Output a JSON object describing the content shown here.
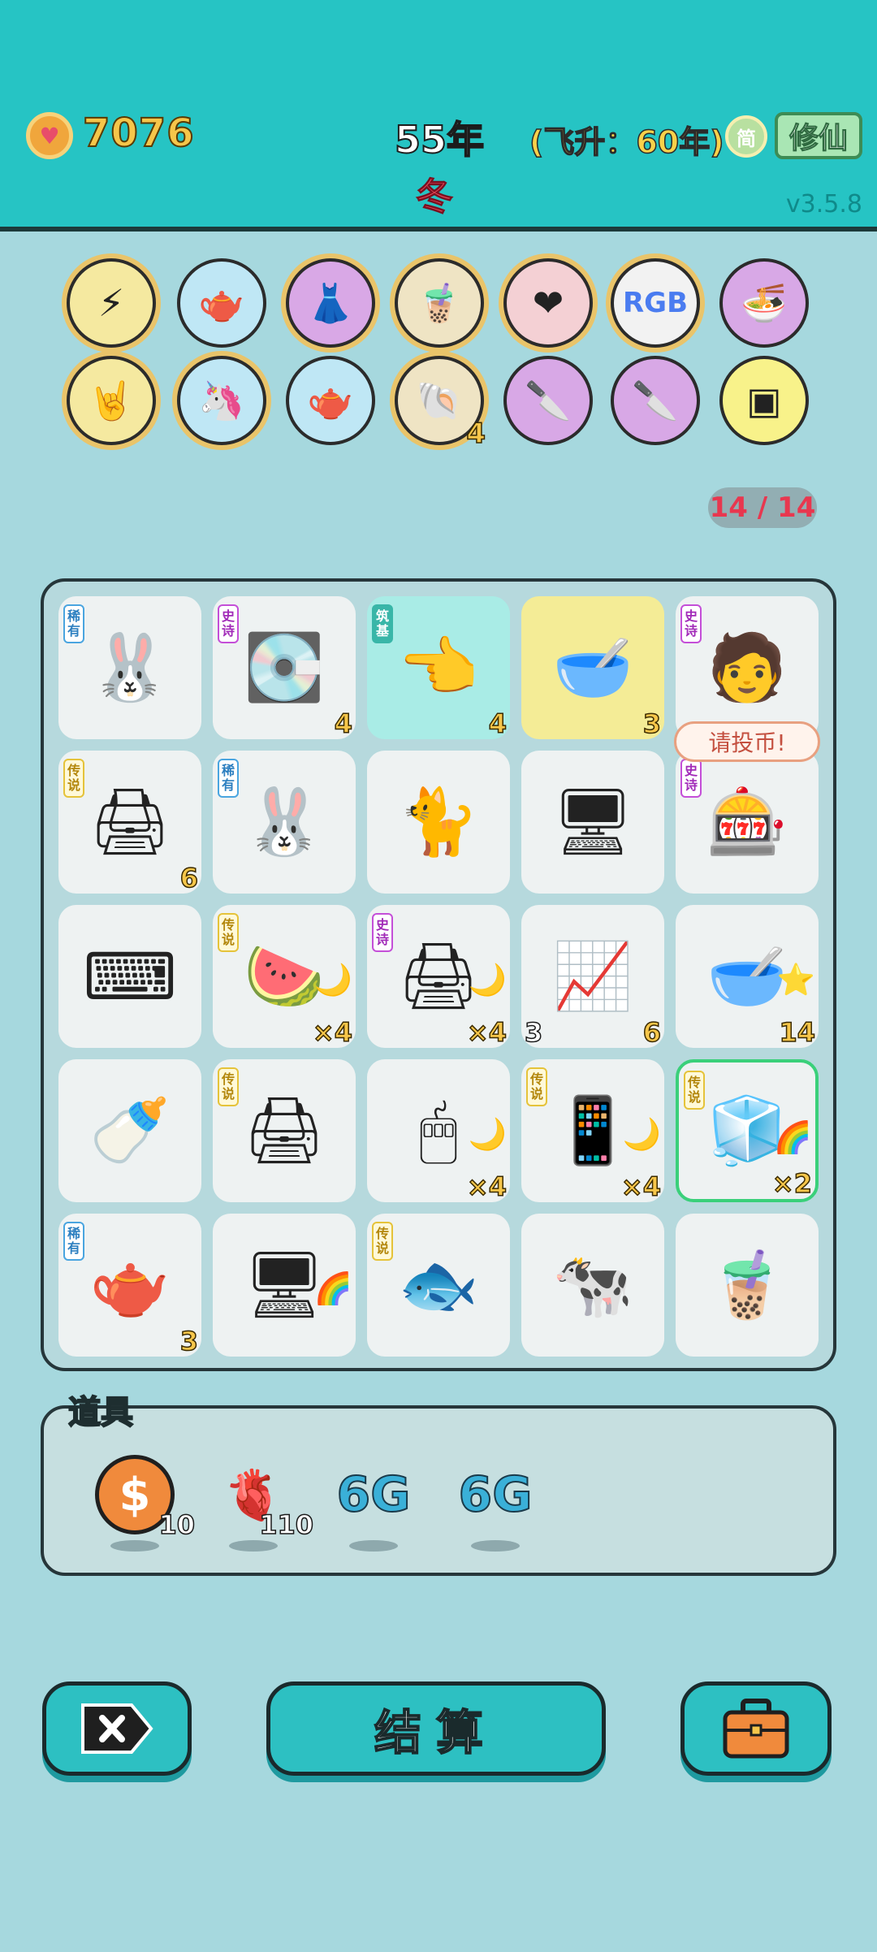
{
  "header": {
    "coins": "7076",
    "year": "55年",
    "season": "冬",
    "ascension": "(飞升：60年)",
    "simplified_label": "简",
    "cultivate_label": "修仙",
    "version": "v3.5.8",
    "colors": {
      "bar": "#26c4c4",
      "coin": "#f6c64a",
      "season": "#ee4a5a"
    }
  },
  "buffs": [
    {
      "icon": "lightning-icon",
      "glyph": "⚡",
      "count": ""
    },
    {
      "icon": "gravy-boat-icon",
      "glyph": "🫖",
      "count": ""
    },
    {
      "icon": "skirt-icon",
      "glyph": "👗",
      "count": ""
    },
    {
      "icon": "boba-tea-icon",
      "glyph": "🧋",
      "count": ""
    },
    {
      "icon": "heart-potion-icon",
      "glyph": "❤",
      "count": ""
    },
    {
      "icon": "rgb-icon",
      "glyph": "RGB",
      "count": ""
    },
    {
      "icon": "ramen-bowls-icon",
      "glyph": "🍜",
      "count": ""
    },
    {
      "icon": "rock-hand-icon",
      "glyph": "🤘",
      "count": ""
    },
    {
      "icon": "unicorn-icon",
      "glyph": "🦄",
      "count": ""
    },
    {
      "icon": "gravy-boat-icon",
      "glyph": "🫖",
      "count": ""
    },
    {
      "icon": "shell-icon",
      "glyph": "🐚",
      "count": "4"
    },
    {
      "icon": "cleaver-icon",
      "glyph": "🔪",
      "count": ""
    },
    {
      "icon": "cleaver-icon",
      "glyph": "🔪",
      "count": ""
    },
    {
      "icon": "cpu-chip-icon",
      "glyph": "▣",
      "count": ""
    }
  ],
  "inventory_counter": "14 / 14",
  "board": {
    "speech_bubble": "请投币!",
    "tiles": [
      {
        "icon": "rabbit-icon",
        "glyph": "🐰",
        "tag": "稀有",
        "tag_type": "rare",
        "count": "",
        "left_count": "",
        "side": ""
      },
      {
        "icon": "graphics-card-icon",
        "glyph": "💽",
        "tag": "史诗",
        "tag_type": "epic",
        "count": "4",
        "left_count": "",
        "side": ""
      },
      {
        "icon": "pointing-hand-icon",
        "glyph": "👈",
        "tag": "筑基",
        "tag_type": "found",
        "count": "4",
        "left_count": "",
        "side": ""
      },
      {
        "icon": "soup-bowl-icon",
        "glyph": "🥣",
        "tag": "",
        "tag_type": "",
        "count": "3",
        "left_count": "",
        "side": ""
      },
      {
        "icon": "face-with-cap-icon",
        "glyph": "🧑",
        "tag": "史诗",
        "tag_type": "epic",
        "count": "",
        "left_count": "",
        "side": ""
      },
      {
        "icon": "printer-icon",
        "glyph": "🖨",
        "tag": "传说",
        "tag_type": "leg",
        "count": "6",
        "left_count": "",
        "side": ""
      },
      {
        "icon": "rabbit-icon",
        "glyph": "🐰",
        "tag": "稀有",
        "tag_type": "rare",
        "count": "",
        "left_count": "",
        "side": ""
      },
      {
        "icon": "cat-icon",
        "glyph": "🐈",
        "tag": "",
        "tag_type": "",
        "count": "",
        "left_count": "",
        "side": ""
      },
      {
        "icon": "monitor-icon",
        "glyph": "🖥",
        "tag": "",
        "tag_type": "",
        "count": "",
        "left_count": "",
        "side": ""
      },
      {
        "icon": "gacha-machine-icon",
        "glyph": "🎰",
        "tag": "史诗",
        "tag_type": "epic",
        "count": "",
        "left_count": "",
        "side": ""
      },
      {
        "icon": "keyboard-icon",
        "glyph": "⌨",
        "tag": "",
        "tag_type": "",
        "count": "",
        "left_count": "",
        "side": ""
      },
      {
        "icon": "watermelon-icon",
        "glyph": "🍉",
        "tag": "传说",
        "tag_type": "leg",
        "count": "×4",
        "left_count": "",
        "side": "🌙"
      },
      {
        "icon": "printer-icon",
        "glyph": "🖨",
        "tag": "史诗",
        "tag_type": "epic",
        "count": "×4",
        "left_count": "",
        "side": "🌙"
      },
      {
        "icon": "stock-chart-icon",
        "glyph": "📈",
        "tag": "",
        "tag_type": "",
        "count": "6",
        "left_count": "3",
        "side": ""
      },
      {
        "icon": "soup-bowl-icon",
        "glyph": "🥣",
        "tag": "",
        "tag_type": "",
        "count": "14",
        "left_count": "",
        "side": "⭐"
      },
      {
        "icon": "milk-bottle-icon",
        "glyph": "🍼",
        "tag": "",
        "tag_type": "",
        "count": "",
        "left_count": "",
        "side": ""
      },
      {
        "icon": "printer-icon",
        "glyph": "🖨",
        "tag": "传说",
        "tag_type": "leg",
        "count": "",
        "left_count": "",
        "side": ""
      },
      {
        "icon": "mouse-icon",
        "glyph": "🖱",
        "tag": "",
        "tag_type": "",
        "count": "×4",
        "left_count": "",
        "side": "🌙"
      },
      {
        "icon": "smartphone-icon",
        "glyph": "📱",
        "tag": "传说",
        "tag_type": "leg",
        "count": "×4",
        "left_count": "",
        "side": "🌙"
      },
      {
        "icon": "fridge-icon",
        "glyph": "🧊",
        "tag": "传说",
        "tag_type": "leg",
        "count": "×2",
        "left_count": "",
        "side": "🌈"
      },
      {
        "icon": "teapot-icon",
        "glyph": "🫖",
        "tag": "稀有",
        "tag_type": "rare",
        "count": "3",
        "left_count": "",
        "side": ""
      },
      {
        "icon": "desktop-computer-icon",
        "glyph": "🖥",
        "tag": "",
        "tag_type": "",
        "count": "",
        "left_count": "",
        "side": "🌈"
      },
      {
        "icon": "koi-fish-icon",
        "glyph": "🐟",
        "tag": "传说",
        "tag_type": "leg",
        "count": "",
        "left_count": "",
        "side": ""
      },
      {
        "icon": "cow-icon",
        "glyph": "🐄",
        "tag": "",
        "tag_type": "",
        "count": "",
        "left_count": "",
        "side": ""
      },
      {
        "icon": "boba-cup-icon",
        "glyph": "🧋",
        "tag": "",
        "tag_type": "",
        "count": "",
        "left_count": "",
        "side": ""
      }
    ]
  },
  "props": {
    "title": "道具",
    "items": [
      {
        "icon": "dollar-coin-icon",
        "glyph": "$",
        "count": "10"
      },
      {
        "icon": "liver-icon",
        "glyph": "🫀",
        "count": "110"
      },
      {
        "icon": "6g-icon",
        "glyph": "6G",
        "count": ""
      },
      {
        "icon": "6g-icon",
        "glyph": "6G",
        "count": ""
      }
    ]
  },
  "buttons": {
    "settle_label": "结算"
  }
}
